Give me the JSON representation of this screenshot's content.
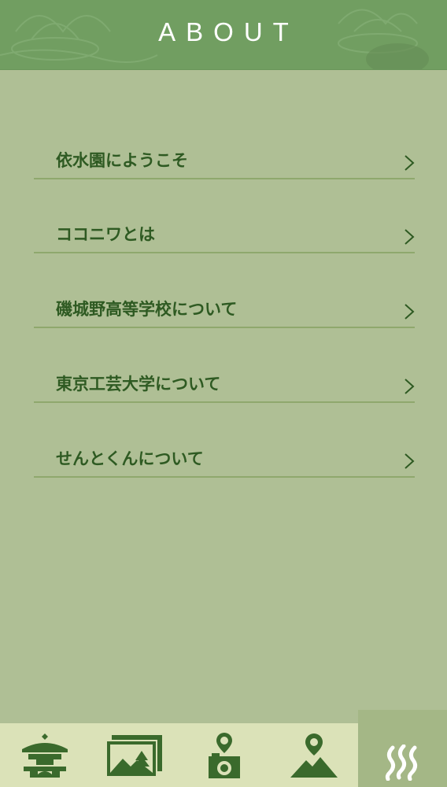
{
  "header": {
    "title": "ABOUT"
  },
  "menu": {
    "items": [
      {
        "label": "依水園にようこそ"
      },
      {
        "label": "ココニワとは"
      },
      {
        "label": "磯城野高等学校について"
      },
      {
        "label": "東京工芸大学について"
      },
      {
        "label": "せんとくんについて"
      }
    ]
  },
  "tabbar": {
    "tabs": [
      {
        "icon": "lantern-icon",
        "active": false
      },
      {
        "icon": "landscape-photo-icon",
        "active": false
      },
      {
        "icon": "camera-pin-icon",
        "active": false
      },
      {
        "icon": "mountain-pin-icon",
        "active": false
      },
      {
        "icon": "onsen-waves-icon",
        "active": true
      }
    ]
  },
  "colors": {
    "header_bg": "#719e61",
    "page_bg": "#afbf95",
    "text": "#2e5a22",
    "tabbar_bg": "#dbe2b8",
    "tab_active_bg": "#a4b786",
    "icon": "#3a6a2c"
  }
}
